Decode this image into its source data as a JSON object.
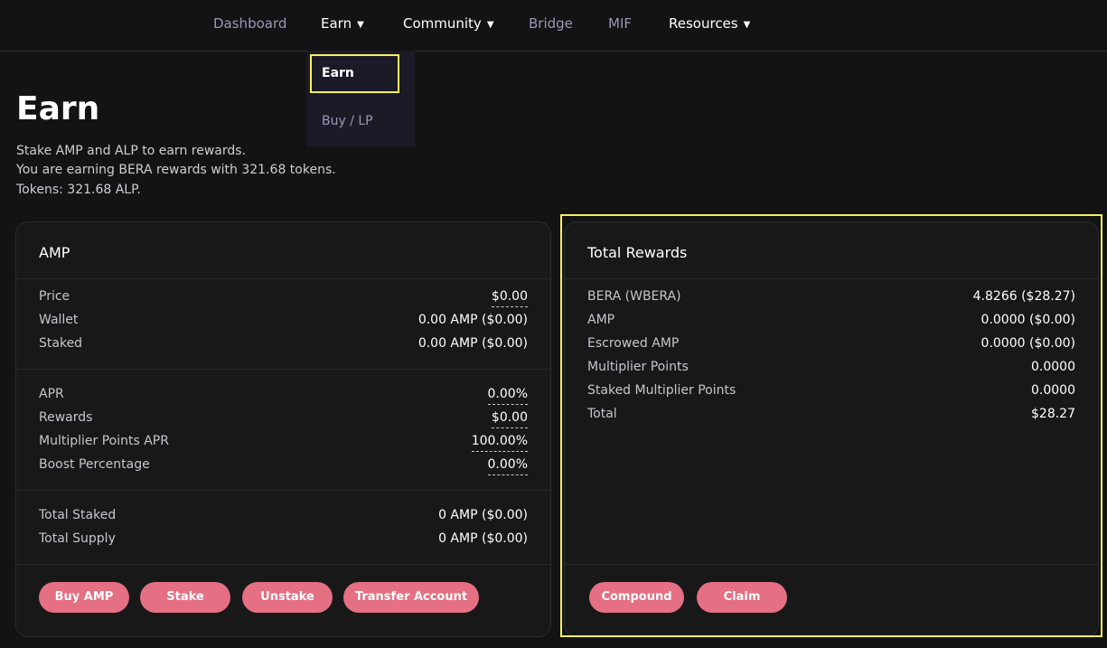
{
  "nav": {
    "dashboard": "Dashboard",
    "earn": "Earn",
    "community": "Community",
    "bridge": "Bridge",
    "mif": "MIF",
    "resources": "Resources",
    "caret": "▼"
  },
  "dropdown": {
    "earn": "Earn",
    "buy_lp": "Buy / LP"
  },
  "page": {
    "title": "Earn",
    "desc1": "Stake AMP and ALP to earn rewards.",
    "desc2": "You are earning BERA rewards with 321.68 tokens.",
    "desc3": "Tokens: 321.68 ALP."
  },
  "amp_card": {
    "title": "AMP",
    "price_label": "Price",
    "price": "$0.00",
    "wallet_label": "Wallet",
    "wallet": "0.00 AMP ($0.00)",
    "staked_label": "Staked",
    "staked": "0.00 AMP ($0.00)",
    "apr_label": "APR",
    "apr": "0.00%",
    "rewards_label": "Rewards",
    "rewards": "$0.00",
    "mp_apr_label": "Multiplier Points APR",
    "mp_apr": "100.00%",
    "boost_label": "Boost Percentage",
    "boost": "0.00%",
    "total_staked_label": "Total Staked",
    "total_staked": "0 AMP ($0.00)",
    "total_supply_label": "Total Supply",
    "total_supply": "0 AMP ($0.00)",
    "btn_buy": "Buy AMP",
    "btn_stake": "Stake",
    "btn_unstake": "Unstake",
    "btn_transfer": "Transfer Account"
  },
  "rewards_card": {
    "title": "Total Rewards",
    "bera_label": "BERA (WBERA)",
    "bera": "4.8266 ($28.27)",
    "amp_label": "AMP",
    "amp": "0.0000 ($0.00)",
    "esc_label": "Escrowed AMP",
    "esc": "0.0000 ($0.00)",
    "mp_label": "Multiplier Points",
    "mp": "0.0000",
    "smp_label": "Staked Multiplier Points",
    "smp": "0.0000",
    "total_label": "Total",
    "total": "$28.27",
    "btn_compound": "Compound",
    "btn_claim": "Claim"
  },
  "colors": {
    "accent": "#e56f83",
    "highlight": "#f4f25a",
    "background": "#141314"
  }
}
